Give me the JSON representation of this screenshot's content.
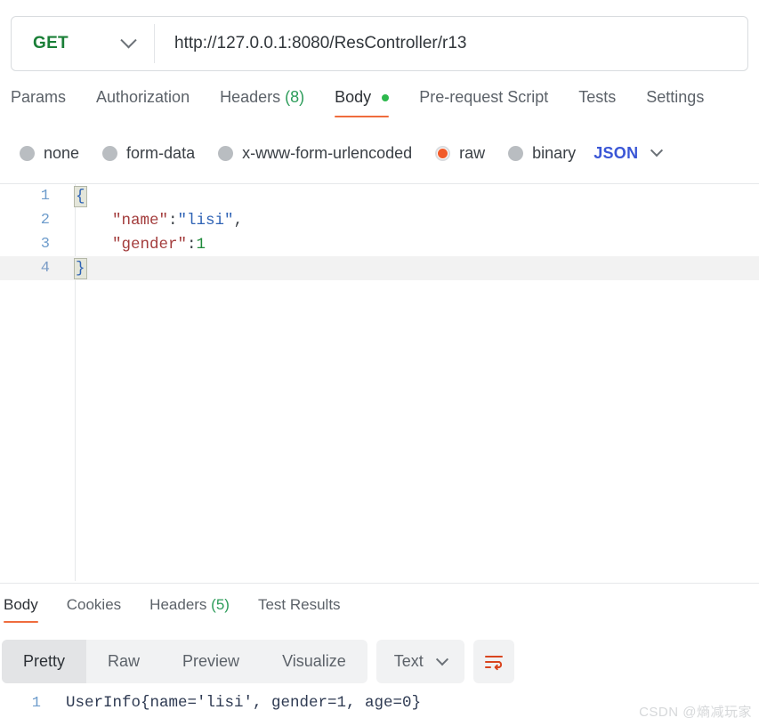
{
  "request": {
    "method": "GET",
    "method_color": "#1a7f37",
    "url": "http://127.0.0.1:8080/ResController/r13",
    "url_placeholder": "Enter request URL",
    "tabs": [
      {
        "label": "Params",
        "active": false
      },
      {
        "label": "Authorization",
        "active": false
      },
      {
        "label": "Headers",
        "count": "(8)",
        "active": false
      },
      {
        "label": "Body",
        "active": true,
        "dot": true
      },
      {
        "label": "Pre-request Script",
        "active": false
      },
      {
        "label": "Tests",
        "active": false
      },
      {
        "label": "Settings",
        "active": false
      }
    ],
    "body_types": [
      {
        "label": "none",
        "selected": false
      },
      {
        "label": "form-data",
        "selected": false
      },
      {
        "label": "x-www-form-urlencoded",
        "selected": false
      },
      {
        "label": "raw",
        "selected": true
      },
      {
        "label": "binary",
        "selected": false
      }
    ],
    "raw_format": "JSON",
    "editor": {
      "lines": [
        {
          "num": "1",
          "active": false
        },
        {
          "num": "2",
          "active": false
        },
        {
          "num": "3",
          "active": false
        },
        {
          "num": "4",
          "active": true
        }
      ],
      "line1_brace": "{",
      "line2_key": "\"name\"",
      "line2_colon": ":",
      "line2_value": "\"lisi\"",
      "line2_comma": ",",
      "line3_key": "\"gender\"",
      "line3_colon": ":",
      "line3_value": "1",
      "line4_brace": "}"
    }
  },
  "response": {
    "tabs": [
      {
        "label": "Body",
        "active": true
      },
      {
        "label": "Cookies",
        "active": false
      },
      {
        "label": "Headers",
        "count": "(5)",
        "active": false
      },
      {
        "label": "Test Results",
        "active": false
      }
    ],
    "view_modes": [
      {
        "label": "Pretty",
        "active": true
      },
      {
        "label": "Raw",
        "active": false
      },
      {
        "label": "Preview",
        "active": false
      },
      {
        "label": "Visualize",
        "active": false
      }
    ],
    "format": "Text",
    "body": {
      "line_number": "1",
      "text": "UserInfo{name='lisi', gender=1, age=0}"
    }
  },
  "watermark": "CSDN @熵减玩家",
  "colors": {
    "accent_orange": "#ef6c3d",
    "green": "#2d9c5a",
    "blue": "#3a56d6",
    "radio_orange": "#f15b2a"
  }
}
